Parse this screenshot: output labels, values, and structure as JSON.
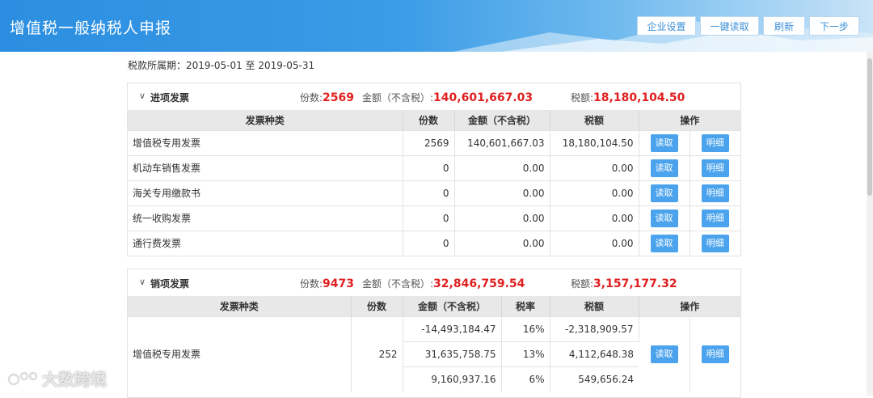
{
  "header": {
    "title": "增值税一般纳税人申报",
    "buttons": {
      "settings": "企业设置",
      "read_all": "一键读取",
      "refresh": "刷新",
      "next": "下一步"
    }
  },
  "period": "税款所属期：2019-05-01 至 2019-05-31",
  "input_invoices": {
    "title": "进项发票",
    "count_label": "份数:",
    "count": "2569",
    "amount_label": "金额（不含税）:",
    "amount": "140,601,667.03",
    "tax_label": "税额:",
    "tax": "18,180,104.50",
    "columns": [
      "发票种类",
      "份数",
      "金额（不含税）",
      "税额",
      "操作"
    ],
    "rows": [
      {
        "type": "增值税专用发票",
        "count": "2569",
        "amount": "140,601,667.03",
        "tax": "18,180,104.50"
      },
      {
        "type": "机动车销售发票",
        "count": "0",
        "amount": "0.00",
        "tax": "0.00"
      },
      {
        "type": "海关专用缴款书",
        "count": "0",
        "amount": "0.00",
        "tax": "0.00"
      },
      {
        "type": "统一收购发票",
        "count": "0",
        "amount": "0.00",
        "tax": "0.00"
      },
      {
        "type": "通行费发票",
        "count": "0",
        "amount": "0.00",
        "tax": "0.00"
      }
    ]
  },
  "output_invoices": {
    "title": "销项发票",
    "count_label": "份数:",
    "count": "9473",
    "amount_label": "金额（不含税）:",
    "amount": "32,846,759.54",
    "tax_label": "税额:",
    "tax": "3,157,177.32",
    "columns": [
      "发票种类",
      "份数",
      "金额（不含税）",
      "税率",
      "税额",
      "操作"
    ],
    "group": {
      "type": "增值税专用发票",
      "count": "252",
      "lines": [
        {
          "amount": "-14,493,184.47",
          "rate": "16%",
          "tax": "-2,318,909.57"
        },
        {
          "amount": "31,635,758.75",
          "rate": "13%",
          "tax": "4,112,648.38"
        },
        {
          "amount": "9,160,937.16",
          "rate": "6%",
          "tax": "549,656.24"
        }
      ]
    }
  },
  "actions": {
    "read": "读取",
    "detail": "明细"
  },
  "watermark": "大数跨境",
  "colors": {
    "header": "#2b8ee0",
    "accent": "#4aa3ec",
    "highlight": "#e02020"
  }
}
